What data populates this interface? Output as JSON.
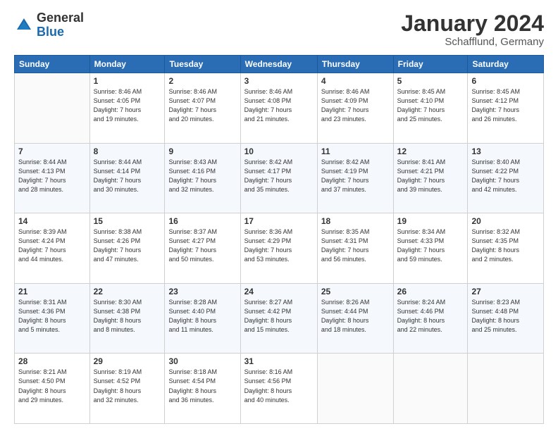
{
  "header": {
    "logo_general": "General",
    "logo_blue": "Blue",
    "title": "January 2024",
    "location": "Schafflund, Germany"
  },
  "days_of_week": [
    "Sunday",
    "Monday",
    "Tuesday",
    "Wednesday",
    "Thursday",
    "Friday",
    "Saturday"
  ],
  "weeks": [
    [
      {
        "day": "",
        "info": ""
      },
      {
        "day": "1",
        "info": "Sunrise: 8:46 AM\nSunset: 4:05 PM\nDaylight: 7 hours\nand 19 minutes."
      },
      {
        "day": "2",
        "info": "Sunrise: 8:46 AM\nSunset: 4:07 PM\nDaylight: 7 hours\nand 20 minutes."
      },
      {
        "day": "3",
        "info": "Sunrise: 8:46 AM\nSunset: 4:08 PM\nDaylight: 7 hours\nand 21 minutes."
      },
      {
        "day": "4",
        "info": "Sunrise: 8:46 AM\nSunset: 4:09 PM\nDaylight: 7 hours\nand 23 minutes."
      },
      {
        "day": "5",
        "info": "Sunrise: 8:45 AM\nSunset: 4:10 PM\nDaylight: 7 hours\nand 25 minutes."
      },
      {
        "day": "6",
        "info": "Sunrise: 8:45 AM\nSunset: 4:12 PM\nDaylight: 7 hours\nand 26 minutes."
      }
    ],
    [
      {
        "day": "7",
        "info": "Sunrise: 8:44 AM\nSunset: 4:13 PM\nDaylight: 7 hours\nand 28 minutes."
      },
      {
        "day": "8",
        "info": "Sunrise: 8:44 AM\nSunset: 4:14 PM\nDaylight: 7 hours\nand 30 minutes."
      },
      {
        "day": "9",
        "info": "Sunrise: 8:43 AM\nSunset: 4:16 PM\nDaylight: 7 hours\nand 32 minutes."
      },
      {
        "day": "10",
        "info": "Sunrise: 8:42 AM\nSunset: 4:17 PM\nDaylight: 7 hours\nand 35 minutes."
      },
      {
        "day": "11",
        "info": "Sunrise: 8:42 AM\nSunset: 4:19 PM\nDaylight: 7 hours\nand 37 minutes."
      },
      {
        "day": "12",
        "info": "Sunrise: 8:41 AM\nSunset: 4:21 PM\nDaylight: 7 hours\nand 39 minutes."
      },
      {
        "day": "13",
        "info": "Sunrise: 8:40 AM\nSunset: 4:22 PM\nDaylight: 7 hours\nand 42 minutes."
      }
    ],
    [
      {
        "day": "14",
        "info": "Sunrise: 8:39 AM\nSunset: 4:24 PM\nDaylight: 7 hours\nand 44 minutes."
      },
      {
        "day": "15",
        "info": "Sunrise: 8:38 AM\nSunset: 4:26 PM\nDaylight: 7 hours\nand 47 minutes."
      },
      {
        "day": "16",
        "info": "Sunrise: 8:37 AM\nSunset: 4:27 PM\nDaylight: 7 hours\nand 50 minutes."
      },
      {
        "day": "17",
        "info": "Sunrise: 8:36 AM\nSunset: 4:29 PM\nDaylight: 7 hours\nand 53 minutes."
      },
      {
        "day": "18",
        "info": "Sunrise: 8:35 AM\nSunset: 4:31 PM\nDaylight: 7 hours\nand 56 minutes."
      },
      {
        "day": "19",
        "info": "Sunrise: 8:34 AM\nSunset: 4:33 PM\nDaylight: 7 hours\nand 59 minutes."
      },
      {
        "day": "20",
        "info": "Sunrise: 8:32 AM\nSunset: 4:35 PM\nDaylight: 8 hours\nand 2 minutes."
      }
    ],
    [
      {
        "day": "21",
        "info": "Sunrise: 8:31 AM\nSunset: 4:36 PM\nDaylight: 8 hours\nand 5 minutes."
      },
      {
        "day": "22",
        "info": "Sunrise: 8:30 AM\nSunset: 4:38 PM\nDaylight: 8 hours\nand 8 minutes."
      },
      {
        "day": "23",
        "info": "Sunrise: 8:28 AM\nSunset: 4:40 PM\nDaylight: 8 hours\nand 11 minutes."
      },
      {
        "day": "24",
        "info": "Sunrise: 8:27 AM\nSunset: 4:42 PM\nDaylight: 8 hours\nand 15 minutes."
      },
      {
        "day": "25",
        "info": "Sunrise: 8:26 AM\nSunset: 4:44 PM\nDaylight: 8 hours\nand 18 minutes."
      },
      {
        "day": "26",
        "info": "Sunrise: 8:24 AM\nSunset: 4:46 PM\nDaylight: 8 hours\nand 22 minutes."
      },
      {
        "day": "27",
        "info": "Sunrise: 8:23 AM\nSunset: 4:48 PM\nDaylight: 8 hours\nand 25 minutes."
      }
    ],
    [
      {
        "day": "28",
        "info": "Sunrise: 8:21 AM\nSunset: 4:50 PM\nDaylight: 8 hours\nand 29 minutes."
      },
      {
        "day": "29",
        "info": "Sunrise: 8:19 AM\nSunset: 4:52 PM\nDaylight: 8 hours\nand 32 minutes."
      },
      {
        "day": "30",
        "info": "Sunrise: 8:18 AM\nSunset: 4:54 PM\nDaylight: 8 hours\nand 36 minutes."
      },
      {
        "day": "31",
        "info": "Sunrise: 8:16 AM\nSunset: 4:56 PM\nDaylight: 8 hours\nand 40 minutes."
      },
      {
        "day": "",
        "info": ""
      },
      {
        "day": "",
        "info": ""
      },
      {
        "day": "",
        "info": ""
      }
    ]
  ]
}
